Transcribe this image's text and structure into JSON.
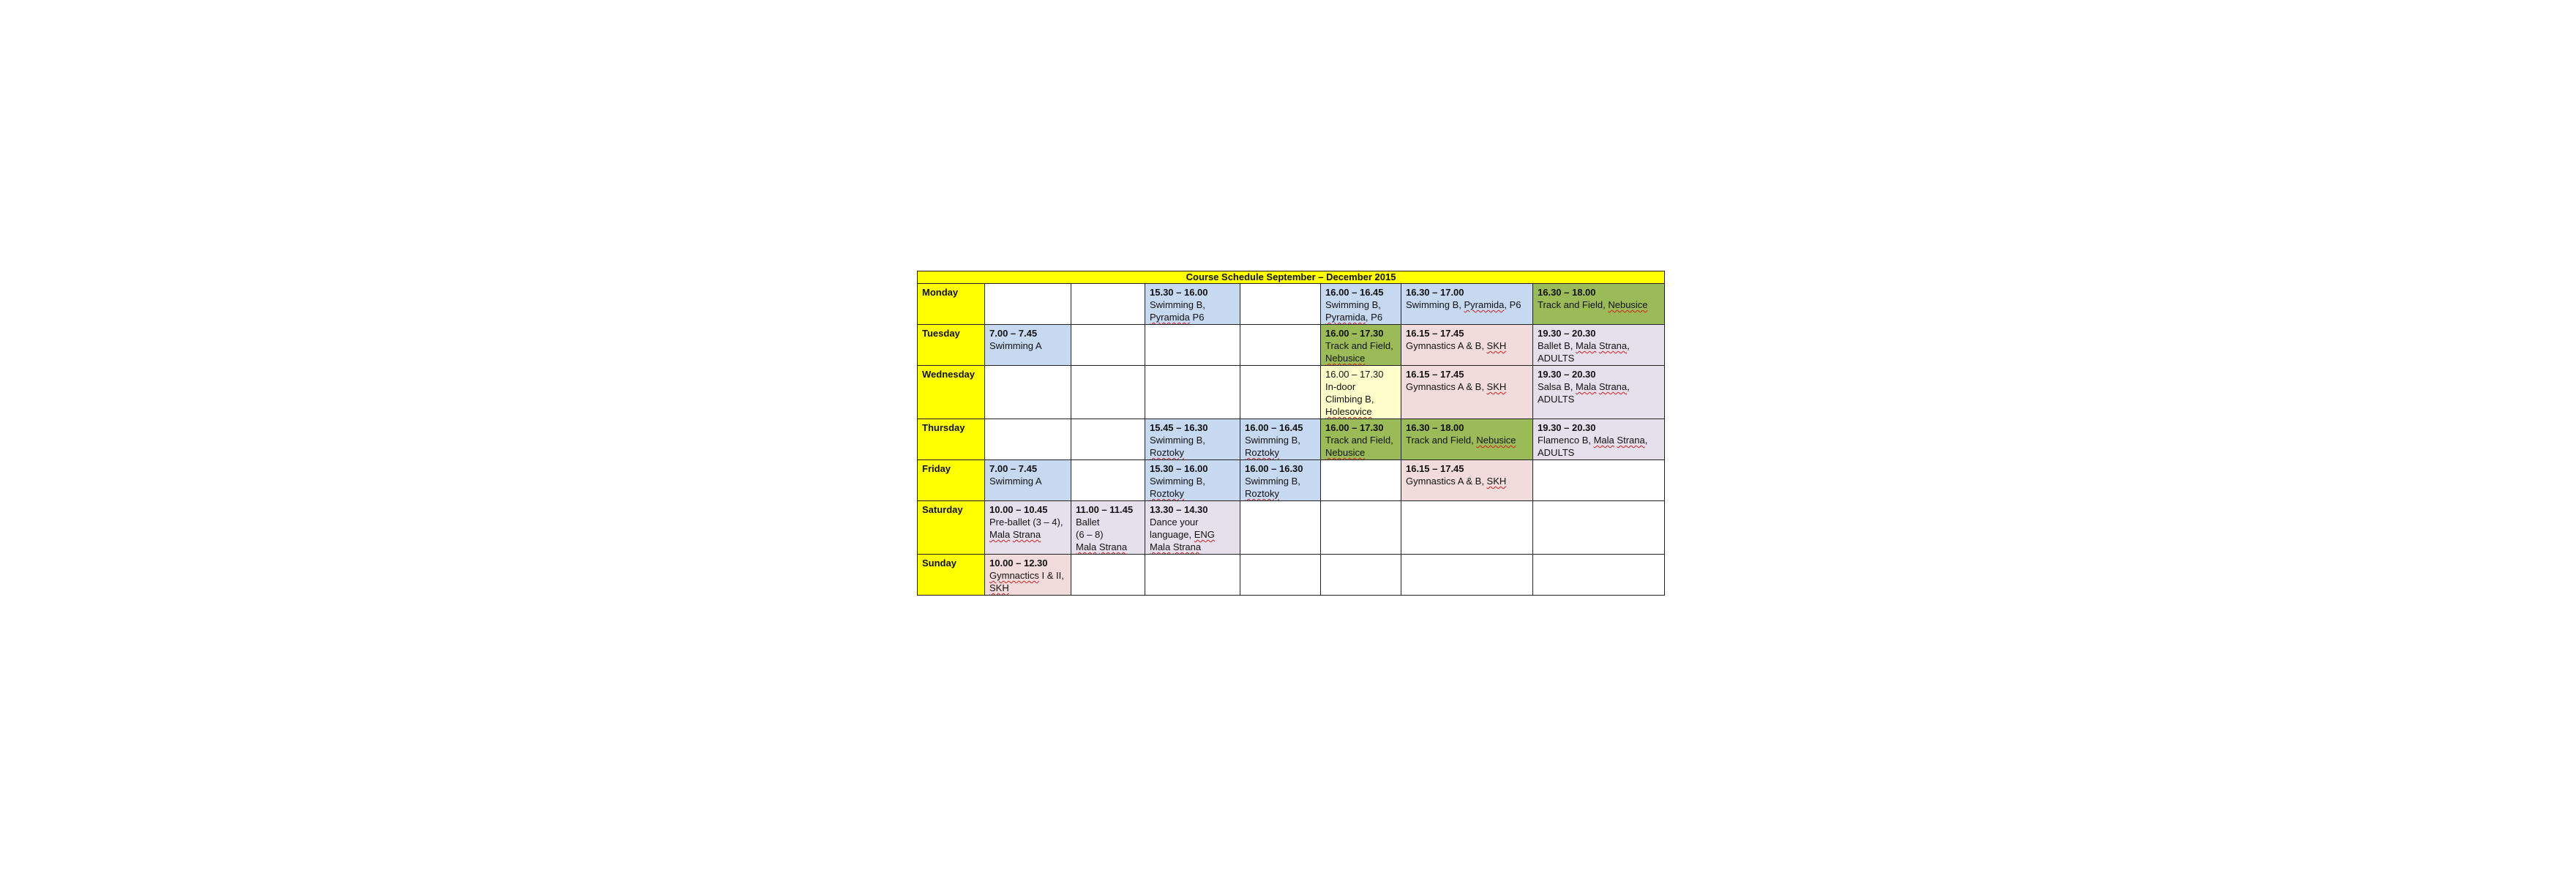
{
  "title": "Course Schedule September – December 2015",
  "rows": [
    {
      "day": "Monday",
      "cells": [
        null,
        null,
        {
          "time": "15.30 – 16.00",
          "lines": [
            "Swimming B,",
            "Pyramida P6"
          ],
          "color": "#c6d9f1"
        },
        null,
        {
          "time": "16.00 – 16.45",
          "lines": [
            "Swimming B,",
            "Pyramida, P6"
          ],
          "color": "#c6d9f1"
        },
        {
          "time": "16.30 – 17.00",
          "lines": [
            "Swimming B, Pyramida, P6"
          ],
          "color": "#c6d9f1"
        },
        {
          "time": "16.30 – 18.00",
          "lines": [
            "Track and Field, Nebusice"
          ],
          "color": "#9bbb59"
        }
      ]
    },
    {
      "day": "Tuesday",
      "cells": [
        {
          "time": "7.00 – 7.45",
          "lines": [
            "Swimming A"
          ],
          "color": "#c6d9f1"
        },
        null,
        null,
        null,
        {
          "time": "16.00 – 17.30",
          "lines": [
            "Track and Field,",
            "Nebusice"
          ],
          "color": "#9bbb59"
        },
        {
          "time": "16.15 – 17.45",
          "lines": [
            "Gymnastics A & B, SKH"
          ],
          "color": "#f2dcdb"
        },
        {
          "time": "19.30 – 20.30",
          "lines": [
            "Ballet B, Mala Strana,",
            "ADULTS"
          ],
          "color": "#e5e0ec"
        }
      ]
    },
    {
      "day": "Wednesday",
      "cells": [
        null,
        null,
        null,
        null,
        {
          "time": "16.00 – 17.30",
          "lines": [
            "In-door",
            "Climbing B,",
            "Holesovice"
          ],
          "color": "#ffffcc",
          "plain": true
        },
        {
          "time": "16.15 – 17.45",
          "lines": [
            "Gymnastics A & B, SKH"
          ],
          "color": "#f2dcdb"
        },
        {
          "time": "19.30 – 20.30",
          "lines": [
            "Salsa B, Mala Strana,",
            "ADULTS"
          ],
          "color": "#e5e0ec"
        }
      ]
    },
    {
      "day": "Thursday",
      "cells": [
        null,
        null,
        {
          "time": "15.45 – 16.30",
          "lines": [
            "Swimming B,",
            "Roztoky"
          ],
          "color": "#c6d9f1"
        },
        {
          "time": "16.00 – 16.45",
          "lines": [
            "Swimming B,",
            "Roztoky"
          ],
          "color": "#c6d9f1"
        },
        {
          "time": "16.00 – 17.30",
          "lines": [
            "Track and Field,",
            "Nebusice"
          ],
          "color": "#9bbb59"
        },
        {
          "time": "16.30 – 18.00",
          "lines": [
            "Track and Field, Nebusice"
          ],
          "color": "#9bbb59"
        },
        {
          "time": "19.30 – 20.30",
          "lines": [
            "Flamenco B, Mala Strana,",
            "ADULTS"
          ],
          "color": "#e5e0ec"
        }
      ]
    },
    {
      "day": "Friday",
      "cells": [
        {
          "time": "7.00 – 7.45",
          "lines": [
            "Swimming A"
          ],
          "color": "#c6d9f1"
        },
        null,
        {
          "time": "15.30 – 16.00",
          "lines": [
            "Swimming B,",
            "Roztoky"
          ],
          "color": "#c6d9f1"
        },
        {
          "time": "16.00 – 16.30",
          "lines": [
            "Swimming B,",
            "Roztoky"
          ],
          "color": "#c6d9f1"
        },
        null,
        {
          "time": "16.15 – 17.45",
          "lines": [
            "Gymnastics A & B, SKH"
          ],
          "color": "#f2dcdb"
        },
        null
      ]
    },
    {
      "day": "Saturday",
      "cells": [
        {
          "time": "10.00 – 10.45",
          "lines": [
            "Pre-ballet (3 – 4),",
            "Mala Strana"
          ],
          "color": "#e5e0ec"
        },
        {
          "time": "11.00 – 11.45",
          "lines": [
            "Ballet",
            "(6 – 8)",
            "Mala Strana"
          ],
          "color": "#e5e0ec"
        },
        {
          "time": "13.30 – 14.30",
          "lines": [
            "Dance your",
            "language, ENG",
            "Mala Strana"
          ],
          "color": "#e5e0ec"
        },
        null,
        null,
        null,
        null
      ]
    },
    {
      "day": "Sunday",
      "cells": [
        {
          "time": "10.00 – 12.30",
          "lines": [
            "Gymnactics I & II,",
            "SKH"
          ],
          "color": "#f2dcdb"
        },
        null,
        null,
        null,
        null,
        null,
        null
      ]
    }
  ]
}
